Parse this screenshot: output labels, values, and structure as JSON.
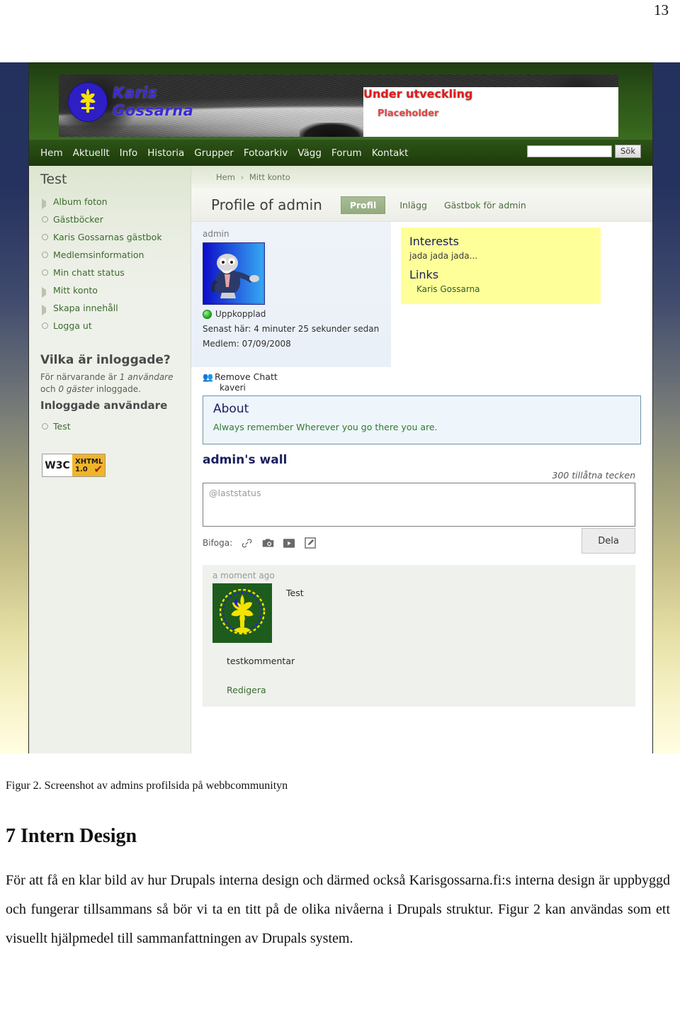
{
  "document": {
    "page_number": "13",
    "figure_caption": "Figur 2. Screenshot av admins profilsida på webbcommunityn",
    "heading": "7 Intern Design",
    "paragraph": "För att få en klar bild av hur Drupals interna design och därmed också Karisgossarna.fi:s interna design är uppbyggd och fungerar tillsammans så bör vi ta en titt på de olika nivåerna i Drupals struktur. Figur 2 kan användas som ett visuellt hjälpmedel till sammanfattningen av Drupals system."
  },
  "screenshot": {
    "header": {
      "logo_line1": "Karis",
      "logo_line2": "Gossarna",
      "banner_main": "Under utveckling",
      "banner_sub": "Placeholder",
      "nav": [
        "Hem",
        "Aktuellt",
        "Info",
        "Historia",
        "Grupper",
        "Fotoarkiv",
        "Vägg",
        "Forum",
        "Kontakt"
      ],
      "search_value": "",
      "search_button": "Sök"
    },
    "breadcrumb": {
      "home": "Hem",
      "separator": "›",
      "current": "Mitt konto"
    },
    "sidebar": {
      "title": "Test",
      "menu": [
        {
          "label": "Album foton",
          "marker": "tri"
        },
        {
          "label": "Gästböcker",
          "marker": "circle"
        },
        {
          "label": "Karis Gossarnas gästbok",
          "marker": "circle"
        },
        {
          "label": "Medlemsinformation",
          "marker": "circle"
        },
        {
          "label": "Min chatt status",
          "marker": "circle"
        },
        {
          "label": "Mitt konto",
          "marker": "tri"
        },
        {
          "label": "Skapa innehåll",
          "marker": "tri"
        },
        {
          "label": "Logga ut",
          "marker": "circle"
        }
      ],
      "online_block": {
        "title": "Vilka är inloggade?",
        "line1_a": "För närvarande är ",
        "line1_em": "1 användare",
        "line2_a": "och ",
        "line2_em": "0 gäster",
        "line2_b": " inloggade.",
        "users_heading": "Inloggade användare",
        "users": [
          "Test"
        ]
      },
      "w3c_badge": {
        "left": "W3C",
        "line1": "XHTML",
        "line2": "1.0",
        "check": "✔"
      }
    },
    "profile": {
      "title": "Profile of admin",
      "tabs": [
        {
          "label": "Profil",
          "active": true
        },
        {
          "label": "Inlägg",
          "active": false
        },
        {
          "label": "Gästbok för admin",
          "active": false
        }
      ],
      "username": "admin",
      "status": "Uppkopplad",
      "last_seen": "Senast här: 4 minuter 25 sekunder sedan",
      "member_since": "Medlem: 07/09/2008",
      "interests_title": "Interests",
      "interests_text": "jada jada jada...",
      "links_title": "Links",
      "links": [
        "Karis Gossarna"
      ],
      "chat_link": "Remove Chatt",
      "chat_sub": "kaveri",
      "about_title": "About",
      "about_text": "Always remember Wherever you go there you are.",
      "wall_title": "admin's wall",
      "allowed_chars": "300 tillåtna tecken",
      "composer_placeholder": "@laststatus",
      "attach_label": "Bifoga:",
      "attach_icons": [
        "link-icon",
        "camera-icon",
        "video-icon",
        "note-icon"
      ],
      "share_button": "Dela",
      "post": {
        "time": "a moment ago",
        "author": "Test",
        "text": "testkommentar",
        "edit_label": "Redigera"
      }
    }
  },
  "colors": {
    "nav_green": "#2c5418",
    "accent_green": "#3d6b2f",
    "yellow_panel": "#ffff99",
    "banner_red": "#e01b1b",
    "logo_blue": "#3b2ad6",
    "page_bg_top": "#24315e"
  }
}
